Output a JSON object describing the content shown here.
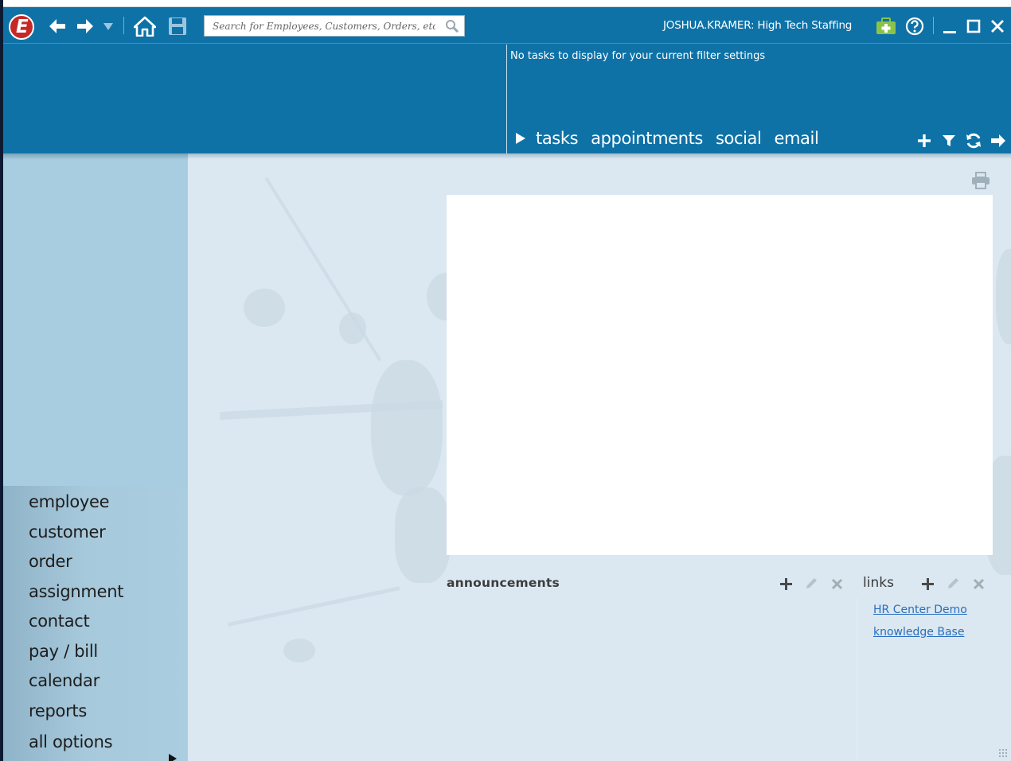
{
  "toolbar": {
    "logo_letter": "E",
    "search_placeholder": "Search for Employees, Customers, Orders, etc.",
    "user_label": "JOSHUA.KRAMER: High Tech Staffing"
  },
  "tasks": {
    "empty_message": "No tasks to display for your current filter settings",
    "tabs": [
      {
        "label": "tasks"
      },
      {
        "label": "appointments"
      },
      {
        "label": "social"
      },
      {
        "label": "email"
      }
    ]
  },
  "nav": {
    "items": [
      {
        "label": "employee"
      },
      {
        "label": "customer"
      },
      {
        "label": "order"
      },
      {
        "label": "assignment"
      },
      {
        "label": "contact"
      },
      {
        "label": "pay / bill"
      },
      {
        "label": "calendar"
      },
      {
        "label": "reports"
      },
      {
        "label": "all options"
      }
    ]
  },
  "announcements": {
    "title": "announcements"
  },
  "links": {
    "title": "links",
    "items": [
      {
        "label": "HR Center Demo"
      },
      {
        "label": "knowledge Base"
      }
    ]
  },
  "colors": {
    "header_blue": "#0e72a7",
    "sidebar_blue": "#a9cde0",
    "main_bg": "#dbe8f1",
    "logo_red": "#c62828",
    "add_green": "#8bc34a",
    "link_blue": "#2a6ebd"
  },
  "icons": [
    "back-arrow-icon",
    "forward-arrow-icon",
    "dropdown-caret-icon",
    "home-icon",
    "save-icon",
    "search-icon",
    "first-aid-kit-icon",
    "help-icon",
    "minimize-icon",
    "maximize-icon",
    "close-icon",
    "play-icon",
    "add-icon",
    "filter-icon",
    "refresh-icon",
    "arrow-right-icon",
    "print-icon",
    "edit-icon",
    "delete-icon"
  ]
}
